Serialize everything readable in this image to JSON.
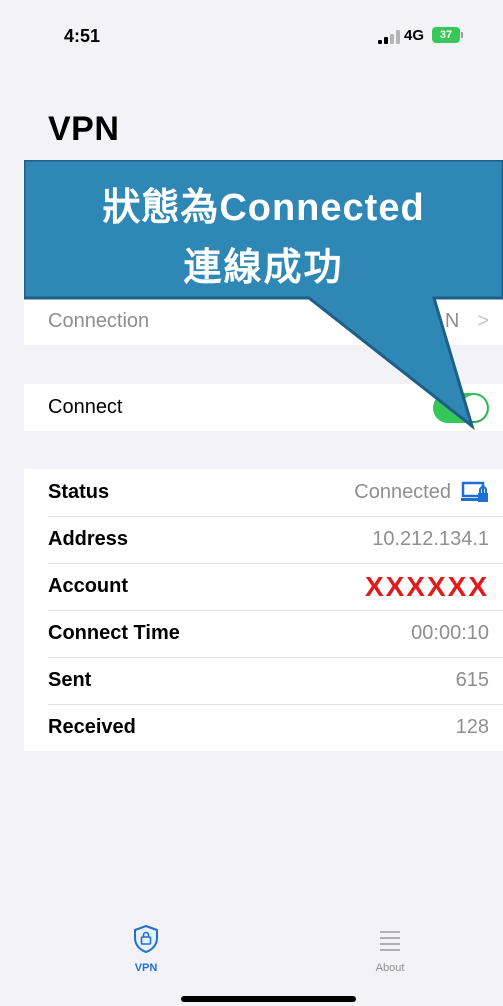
{
  "status_bar": {
    "time": "4:51",
    "network": "4G",
    "battery": "37"
  },
  "title": "VPN",
  "callout": {
    "line1": "狀態為Connected",
    "line2": "連線成功"
  },
  "connection_row": {
    "label": "Connection",
    "value": "NP",
    "value_tail": "N"
  },
  "connect_row": {
    "label": "Connect",
    "toggle_on": true
  },
  "details": [
    {
      "label": "Status",
      "value": "Connected"
    },
    {
      "label": "Address",
      "value": "10.212.134.1"
    },
    {
      "label": "Account",
      "value": "XXXXXX"
    },
    {
      "label": "Connect Time",
      "value": "00:00:10"
    },
    {
      "label": "Sent",
      "value": "615"
    },
    {
      "label": "Received",
      "value": "128"
    }
  ],
  "tabs": [
    {
      "label": "VPN",
      "icon": "shield-lock-icon",
      "active": true
    },
    {
      "label": "About",
      "icon": "list-icon",
      "active": false
    }
  ],
  "colors": {
    "accent": "#1f6fd1",
    "toggle": "#34c759",
    "callout": "#2e87b5",
    "redacted": "#e11b1b"
  }
}
